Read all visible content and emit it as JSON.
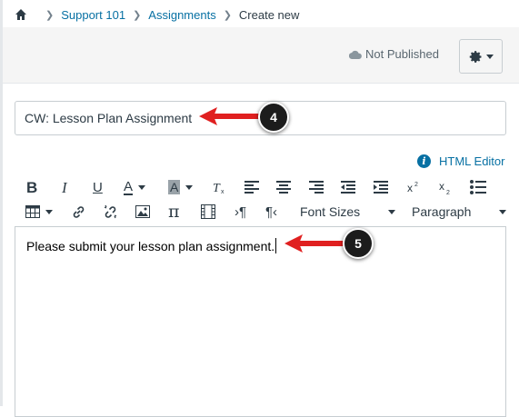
{
  "breadcrumb": {
    "items": [
      {
        "label": "Support 101"
      },
      {
        "label": "Assignments"
      }
    ],
    "current": "Create new"
  },
  "header": {
    "status": "Not Published"
  },
  "form": {
    "title_value": "CW: Lesson Plan Assignment"
  },
  "editor": {
    "html_editor_label": "HTML Editor",
    "font_sizes_label": "Font Sizes",
    "paragraph_label": "Paragraph",
    "content": "Please submit your lesson plan assignment."
  },
  "annotations": {
    "step_a": "4",
    "step_b": "5"
  },
  "colors": {
    "link": "#0770a3",
    "arrow": "#e02020",
    "badge": "#1c1c1c"
  }
}
